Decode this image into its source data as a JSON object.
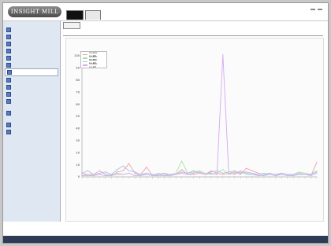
{
  "header": {
    "logo_text": "INSIGHT MILL",
    "tabs": [
      {
        "label": "",
        "active": true
      },
      {
        "label": "",
        "active": false
      }
    ],
    "info_text": "",
    "buttons": [
      "",
      ""
    ]
  },
  "sidebar": {
    "sections": [
      {
        "title": "",
        "items": [
          {
            "label": "",
            "active": false
          },
          {
            "label": "",
            "active": false
          },
          {
            "label": "",
            "active": false
          },
          {
            "label": "",
            "active": false
          },
          {
            "label": "",
            "active": false
          },
          {
            "label": "",
            "active": false
          },
          {
            "label": "",
            "active": true
          },
          {
            "label": "",
            "active": false
          },
          {
            "label": "",
            "active": false
          },
          {
            "label": "",
            "active": false
          },
          {
            "label": "",
            "active": false
          }
        ]
      },
      {
        "title": "",
        "items": [
          {
            "label": "",
            "active": false
          }
        ]
      },
      {
        "title": "",
        "items": [
          {
            "label": "",
            "active": false
          },
          {
            "label": "",
            "active": false
          }
        ]
      }
    ]
  },
  "main": {
    "subtab_label": "",
    "page_title": ""
  },
  "footer": {
    "text": ""
  },
  "chart_data": {
    "type": "line",
    "title": "",
    "xlabel": "",
    "ylabel": "",
    "ylim": [
      0,
      100
    ],
    "yticks": [
      0,
      10,
      20,
      30,
      40,
      50,
      60,
      70,
      80,
      90,
      100
    ],
    "grid": false,
    "legend_position": "top-left",
    "categories": [
      "",
      "",
      "",
      "",
      "",
      "",
      "",
      "",
      "",
      "",
      "",
      "",
      "",
      "",
      "",
      "",
      "",
      "",
      "",
      "",
      "",
      "",
      "",
      "",
      "",
      "",
      "",
      "",
      "",
      "",
      "",
      "",
      "",
      "",
      "",
      "",
      "",
      "",
      "",
      "",
      ""
    ],
    "series": [
      {
        "name": "Cluster no.#0",
        "color": "#f4a0a0",
        "values": [
          3,
          2,
          2,
          5,
          2,
          1,
          4,
          5,
          11,
          3,
          2,
          8,
          1,
          2,
          2,
          1,
          2,
          6,
          2,
          3,
          4,
          2,
          5,
          3,
          2,
          3,
          4,
          2,
          7,
          5,
          3,
          2,
          2,
          1,
          3,
          2,
          1,
          2,
          2,
          1,
          12
        ]
      },
      {
        "name": "Cluster no.#1",
        "color": "#a8e6a0",
        "values": [
          1,
          2,
          1,
          2,
          1,
          2,
          3,
          2,
          3,
          1,
          2,
          2,
          1,
          3,
          2,
          2,
          3,
          13,
          3,
          4,
          5,
          3,
          2,
          3,
          6,
          2,
          3,
          4,
          2,
          2,
          2,
          3,
          2,
          1,
          2,
          1,
          2,
          4,
          3,
          2,
          5
        ]
      },
      {
        "name": "Cluster no.#2",
        "color": "#a0c4f4",
        "values": [
          3,
          5,
          2,
          3,
          4,
          2,
          6,
          9,
          5,
          4,
          2,
          3,
          2,
          2,
          3,
          2,
          2,
          4,
          3,
          5,
          3,
          2,
          4,
          5,
          3,
          4,
          5,
          3,
          4,
          3,
          2,
          2,
          3,
          2,
          3,
          2,
          2,
          3,
          2,
          2,
          4
        ]
      },
      {
        "name": "Cluster no.#3",
        "color": "#d8a8f0",
        "values": [
          1,
          1,
          1,
          2,
          1,
          1,
          2,
          2,
          3,
          1,
          1,
          2,
          1,
          1,
          1,
          1,
          2,
          3,
          2,
          2,
          3,
          2,
          3,
          2,
          101,
          3,
          2,
          5,
          3,
          2,
          1,
          1,
          2,
          1,
          2,
          1,
          1,
          2,
          2,
          1,
          3
        ]
      }
    ]
  }
}
